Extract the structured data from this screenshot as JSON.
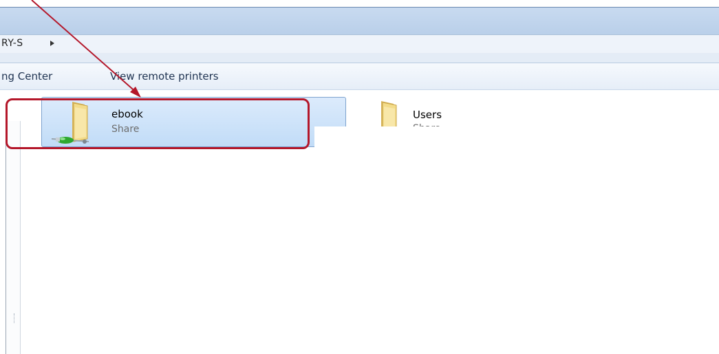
{
  "address": {
    "breadcrumb": "RY-S"
  },
  "toolbar": {
    "items": [
      "ng Center",
      "View remote printers"
    ]
  },
  "items": [
    {
      "name": "ebook",
      "type": "Share",
      "selected": true
    },
    {
      "name": "Users",
      "type": "Share",
      "selected": false
    }
  ],
  "colors": {
    "annotation": "#b4172a",
    "selection": "#c1dcf7"
  }
}
